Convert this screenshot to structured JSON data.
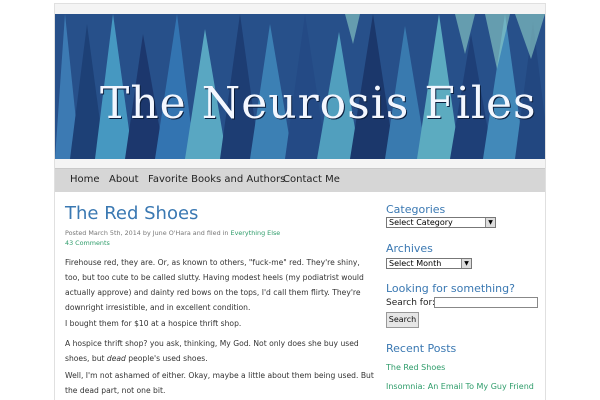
{
  "site": {
    "title": "The Neurosis Files"
  },
  "nav": {
    "items": [
      "Home",
      "About",
      "Favorite Books and Authors",
      "Contact Me"
    ]
  },
  "post": {
    "title": "The Red Shoes",
    "meta_prefix": "Posted March 5th, 2014 by June O'Hara and filed in ",
    "meta_category": "Everything Else",
    "comments": "43 Comments",
    "paragraphs": [
      "Firehouse red, they are. Or, as known to others, \"fuck-me\" red. They're shiny, too, but too cute to be called slutty. Having modest heels (my podiatrist would actually approve) and dainty red bows on the tops, I'd call them flirty. They're downright irresistible, and in excellent condition.",
      "I bought them for $10 at a hospice thrift shop.",
      "A hospice thrift shop? you ask, thinking, My God. Not only does she buy used shoes, but ",
      "Well, I'm not ashamed of either. Okay, maybe a little about them being used. But the dead part, not one bit."
    ],
    "para3_italic": "dead",
    "para3_end": " people's used shoes."
  },
  "sidebar": {
    "categories_heading": "Categories",
    "categories_select": "Select Category",
    "archives_heading": "Archives",
    "archives_select": "Select Month",
    "search_heading": "Looking for something?",
    "search_label": "Search for:",
    "search_button": "Search",
    "recent_heading": "Recent Posts",
    "recent_posts": [
      "The Red Shoes",
      "Insomnia: An Email To My Guy Friend"
    ]
  },
  "colors": {
    "accent_blue": "#3a78b2",
    "link_green": "#2e9c6a",
    "nav_bg": "#d6d6d6"
  }
}
